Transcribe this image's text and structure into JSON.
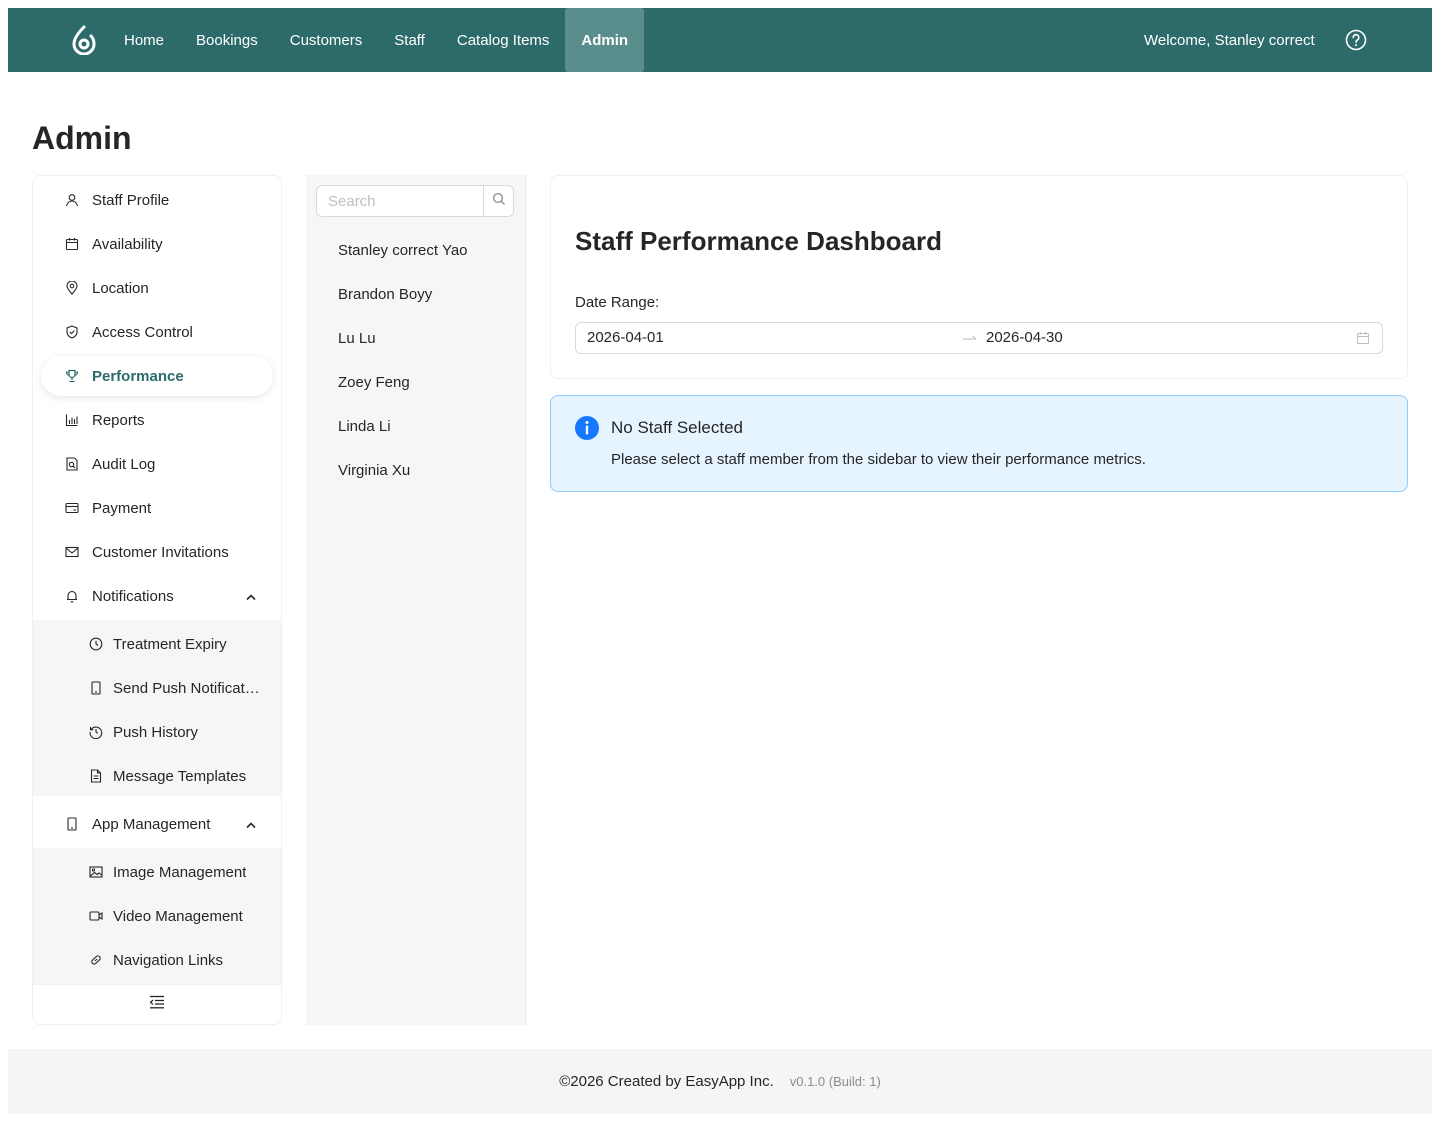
{
  "nav": {
    "items": [
      {
        "label": "Home"
      },
      {
        "label": "Bookings"
      },
      {
        "label": "Customers"
      },
      {
        "label": "Staff"
      },
      {
        "label": "Catalog Items"
      },
      {
        "label": "Admin"
      }
    ],
    "active": "Admin",
    "welcome": "Welcome, Stanley correct"
  },
  "page": {
    "title": "Admin"
  },
  "menu": {
    "items": [
      {
        "label": "Staff Profile",
        "icon": "user-icon"
      },
      {
        "label": "Availability",
        "icon": "calendar-icon"
      },
      {
        "label": "Location",
        "icon": "location-pin-icon"
      },
      {
        "label": "Access Control",
        "icon": "shield-check-icon"
      },
      {
        "label": "Performance",
        "icon": "trophy-icon"
      },
      {
        "label": "Reports",
        "icon": "bar-chart-icon"
      },
      {
        "label": "Audit Log",
        "icon": "file-search-icon"
      },
      {
        "label": "Payment",
        "icon": "credit-card-icon"
      },
      {
        "label": "Customer Invitations",
        "icon": "mail-icon"
      },
      {
        "label": "Notifications",
        "icon": "bell-icon"
      },
      {
        "label": "App Management",
        "icon": "mobile-icon"
      }
    ],
    "selected": "Performance",
    "notifications_sub": [
      {
        "label": "Treatment Expiry",
        "icon": "clock-icon"
      },
      {
        "label": "Send Push Notifications",
        "icon": "mobile-icon"
      },
      {
        "label": "Push History",
        "icon": "history-icon"
      },
      {
        "label": "Message Templates",
        "icon": "document-icon"
      }
    ],
    "app_sub": [
      {
        "label": "Image Management",
        "icon": "picture-icon"
      },
      {
        "label": "Video Management",
        "icon": "video-camera-icon"
      },
      {
        "label": "Navigation Links",
        "icon": "link-icon"
      }
    ]
  },
  "staff": {
    "search_placeholder": "Search",
    "members": [
      "Stanley correct Yao",
      "Brandon Boyy",
      "Lu Lu",
      "Zoey Feng",
      "Linda Li",
      "Virginia Xu"
    ]
  },
  "dashboard": {
    "title": "Staff Performance Dashboard",
    "date_label": "Date Range:",
    "start_date": "2026-04-01",
    "end_date": "2026-04-30"
  },
  "alert": {
    "title": "No Staff Selected",
    "description": "Please select a staff member from the sidebar to view their performance metrics."
  },
  "footer": {
    "copyright": "©2026 Created by EasyApp Inc.",
    "version": "v0.1.0 (Build: 1)"
  },
  "colors": {
    "brand": "#2d6b6b",
    "nav_active": "#5a8e8c",
    "alert_bg": "#e6f4ff",
    "alert_border": "#91caff",
    "info_icon": "#1677ff"
  }
}
